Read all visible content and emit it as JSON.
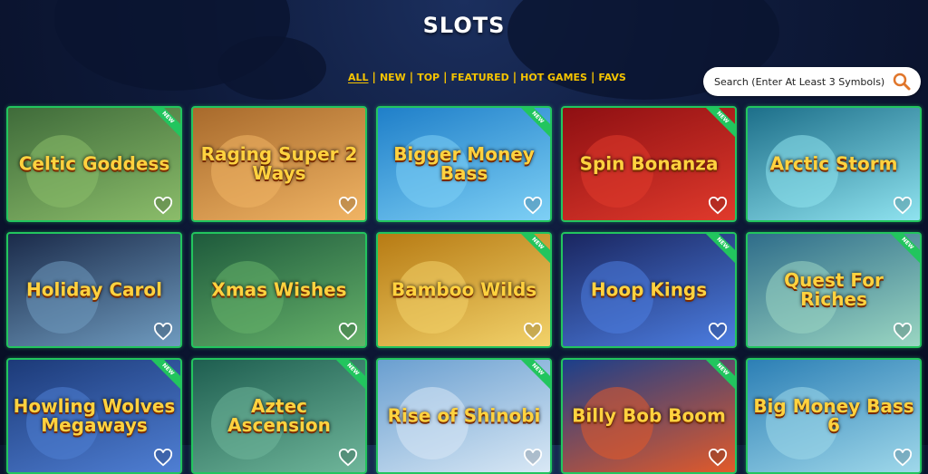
{
  "header": {
    "title": "SLOTS"
  },
  "filters": [
    {
      "label": "ALL",
      "active": true
    },
    {
      "label": "NEW",
      "active": false
    },
    {
      "label": "TOP",
      "active": false
    },
    {
      "label": "FEATURED",
      "active": false
    },
    {
      "label": "HOT GAMES",
      "active": false
    },
    {
      "label": "FAVS",
      "active": false
    }
  ],
  "search": {
    "placeholder": "Search (Enter At Least 3 Symbols)",
    "icon": "search-icon"
  },
  "colors": {
    "accent": "#f6c400",
    "tile_border": "#22c55e",
    "badge": "#22c55e"
  },
  "games": [
    {
      "name": "Celtic Goddess",
      "new": true,
      "bg": [
        "#3f6b3a",
        "#8bbd6a"
      ]
    },
    {
      "name": "Raging Super 2 Ways",
      "new": false,
      "bg": [
        "#a86a2c",
        "#f0b464"
      ]
    },
    {
      "name": "Bigger Money Bass",
      "new": true,
      "bg": [
        "#1f7fc9",
        "#7ed0f5"
      ]
    },
    {
      "name": "Spin Bonanza",
      "new": true,
      "bg": [
        "#8e0f12",
        "#e03a2c"
      ]
    },
    {
      "name": "Arctic Storm",
      "new": false,
      "bg": [
        "#1d6f8a",
        "#8fe3ef"
      ]
    },
    {
      "name": "Holiday Carol",
      "new": false,
      "bg": [
        "#1b2b4a",
        "#6f9bbf"
      ]
    },
    {
      "name": "Xmas Wishes",
      "new": false,
      "bg": [
        "#1e5a3c",
        "#66b26a"
      ]
    },
    {
      "name": "Bamboo Wilds",
      "new": true,
      "bg": [
        "#b77b14",
        "#f2d26a"
      ]
    },
    {
      "name": "Hoop Kings",
      "new": true,
      "bg": [
        "#1a2660",
        "#4c7de0"
      ]
    },
    {
      "name": "Quest For Riches",
      "new": true,
      "bg": [
        "#2f6d8a",
        "#9ad6c2"
      ]
    },
    {
      "name": "Howling Wolves Megaways",
      "new": true,
      "bg": [
        "#1c3a78",
        "#4f7fd4"
      ]
    },
    {
      "name": "Aztec Ascension",
      "new": true,
      "bg": [
        "#1e5e50",
        "#6fb69a"
      ]
    },
    {
      "name": "Rise of Shinobi",
      "new": true,
      "bg": [
        "#6a9fd0",
        "#d9e8f5"
      ]
    },
    {
      "name": "Billy Bob Boom",
      "new": true,
      "bg": [
        "#1b3f8a",
        "#e25a2a"
      ]
    },
    {
      "name": "Big Money Bass 6",
      "new": false,
      "bg": [
        "#2c7fb5",
        "#9fd8ea"
      ]
    }
  ],
  "labels": {
    "new_badge": "NEW"
  }
}
